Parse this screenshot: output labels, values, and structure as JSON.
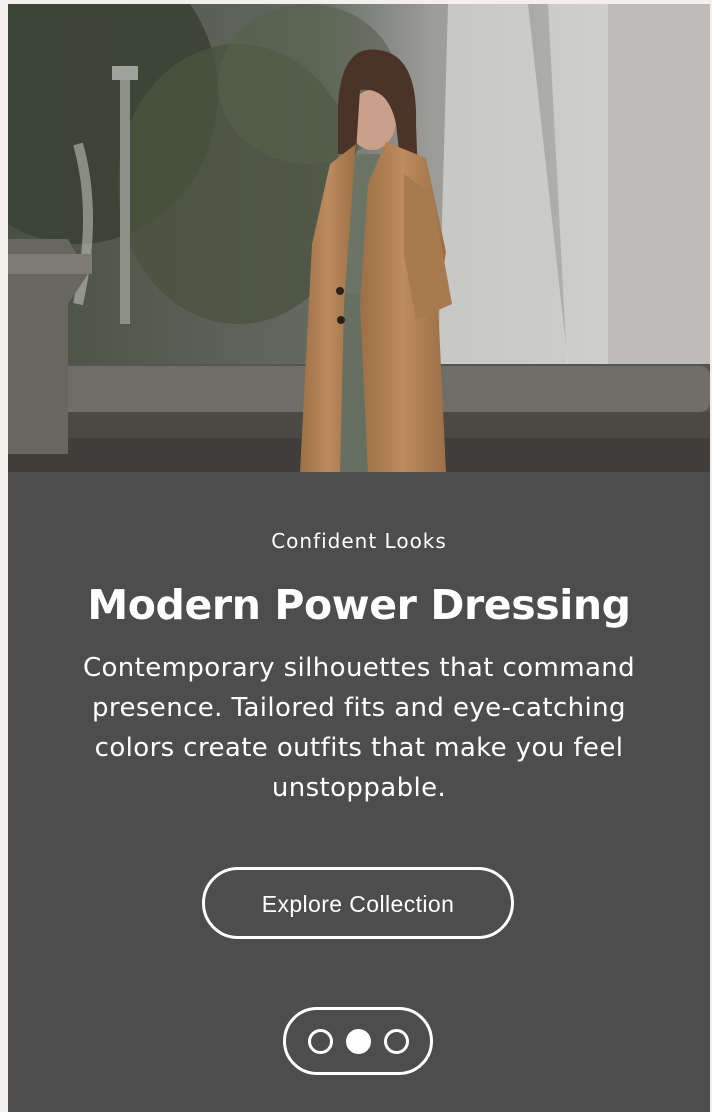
{
  "hero": {
    "image_alt": "Woman in a camel coat standing beside a fountain"
  },
  "slide": {
    "kicker": "Confident Looks",
    "title": "Modern Power Dressing",
    "description": "Contemporary silhouettes that command presence. Tailored fits and eye-catching colors create outfits that make you feel unstoppable.",
    "button_label": "Explore Collection"
  },
  "pagination": {
    "current": 2,
    "total": 3
  },
  "colors": {
    "panel_background": "#4d4d4d",
    "text": "#ffffff",
    "coat": "#b9875a"
  }
}
